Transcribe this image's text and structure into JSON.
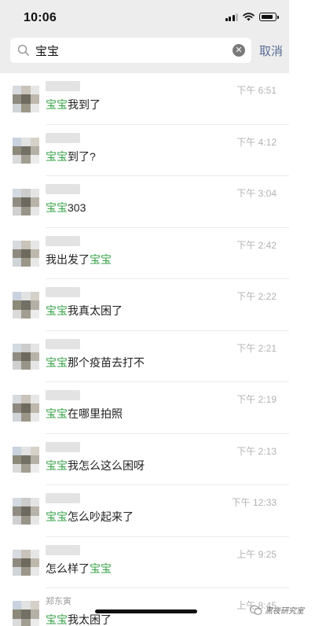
{
  "status": {
    "time": "10:06"
  },
  "search": {
    "value": "宝宝",
    "cancel_label": "取消"
  },
  "results": [
    {
      "time": "下午 6:51",
      "parts": [
        {
          "t": "宝宝",
          "hl": true
        },
        {
          "t": "我到了",
          "hl": false
        }
      ]
    },
    {
      "time": "下午 4:12",
      "parts": [
        {
          "t": "宝宝",
          "hl": true
        },
        {
          "t": "到了?",
          "hl": false
        }
      ]
    },
    {
      "time": "下午 3:04",
      "parts": [
        {
          "t": "宝宝",
          "hl": true
        },
        {
          "t": "303",
          "hl": false
        }
      ]
    },
    {
      "time": "下午 2:42",
      "parts": [
        {
          "t": "我出发了",
          "hl": false
        },
        {
          "t": "宝宝",
          "hl": true
        }
      ]
    },
    {
      "time": "下午 2:22",
      "parts": [
        {
          "t": "宝宝",
          "hl": true
        },
        {
          "t": "我真太困了",
          "hl": false
        }
      ]
    },
    {
      "time": "下午 2:21",
      "parts": [
        {
          "t": "宝宝",
          "hl": true
        },
        {
          "t": "那个疫苗去打不",
          "hl": false
        }
      ]
    },
    {
      "time": "下午 2:19",
      "parts": [
        {
          "t": "宝宝",
          "hl": true
        },
        {
          "t": "在哪里拍照",
          "hl": false
        }
      ]
    },
    {
      "time": "下午 2:13",
      "parts": [
        {
          "t": "宝宝",
          "hl": true
        },
        {
          "t": "我怎么这么困呀",
          "hl": false
        }
      ]
    },
    {
      "time": "下午 12:33",
      "parts": [
        {
          "t": "宝宝",
          "hl": true
        },
        {
          "t": "怎么吵起来了",
          "hl": false
        }
      ]
    },
    {
      "time": "上午 9:25",
      "parts": [
        {
          "t": "怎么样了",
          "hl": false
        },
        {
          "t": "宝宝",
          "hl": true
        }
      ]
    },
    {
      "time": "上午 8:45",
      "name": "郑东寅",
      "parts": [
        {
          "t": "宝宝",
          "hl": true
        },
        {
          "t": "我太困了",
          "hl": false
        }
      ]
    }
  ],
  "watermark": {
    "text": "黑夜研究室",
    "icon": "wechat-official-account-icon"
  },
  "colors": {
    "highlight": "#3aa34a",
    "link": "#576b95",
    "header_bg": "#ededed",
    "time_gray": "#b2b2b2"
  },
  "icons": {
    "search": "search-icon",
    "clear": "clear-circle-icon",
    "signal": "cellular-signal-icon",
    "wifi": "wifi-icon",
    "battery": "battery-icon"
  }
}
